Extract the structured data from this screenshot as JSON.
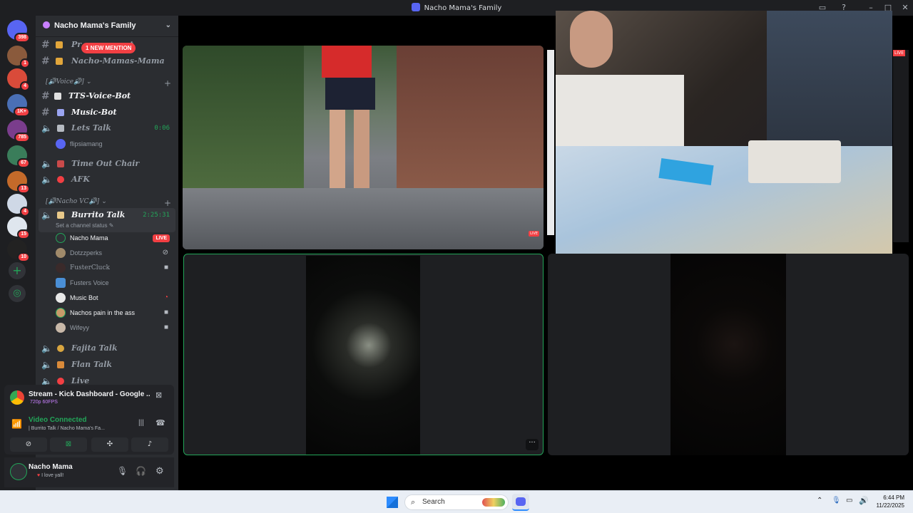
{
  "window": {
    "title": "Nacho Mama's Family"
  },
  "rail": {
    "badges": [
      "398",
      "1",
      "4",
      "1K+",
      "785",
      "67",
      "13",
      "4",
      "15",
      "10"
    ]
  },
  "guild": {
    "name": "Nacho Mama's Family",
    "mention_pill": "1 NEW MENTION"
  },
  "channels": {
    "text1": "Pr",
    "text1_tail": "t",
    "text2": "Nacho-Mamas-Mama",
    "cat_voice": "[🔊Voice🔊]",
    "tts": "TTS-Voice-Bot",
    "music": "Music-Bot",
    "lets_talk": "Lets Talk",
    "lets_talk_time": "0:06",
    "lets_talk_user": "flipsiamang",
    "timeout": "Time Out Chair",
    "afk": "AFK",
    "cat_nacho": "[🔊Nacho VC🔊]",
    "burrito": "Burrito Talk",
    "burrito_time": "2:25:31",
    "burrito_status": "Set a channel status",
    "fajita": "Fajita Talk",
    "flan": "Flan Talk",
    "live": "Live"
  },
  "burrito_users": [
    {
      "name": "Nacho Mama",
      "tag": "LIVE"
    },
    {
      "name": "Dotzzperks",
      "tag": ""
    },
    {
      "name": "FusterCluck",
      "tag": ""
    },
    {
      "name": "Fusters Voice",
      "tag": ""
    },
    {
      "name": "Music Bot",
      "tag": ""
    },
    {
      "name": "Nachos pain in the ass",
      "tag": ""
    },
    {
      "name": "Wifeyy",
      "tag": ""
    }
  ],
  "stream_panel": {
    "title": "Stream - Kick Dashboard - Google ...",
    "quality": "720p 60FPS",
    "voice_status": "Video Connected",
    "voice_channel": "| Burrito Talk / Nacho Mama's Fa..."
  },
  "user_panel": {
    "username": "Nacho Mama",
    "status": "I love yall!"
  },
  "stage": {
    "live_tag": "LIVE"
  },
  "taskbar": {
    "search_label": "Search",
    "time": "6:44 PM",
    "date": "11/22/2025"
  },
  "colors": {
    "accent": "#5865f2",
    "online": "#23a559",
    "danger": "#f23f43"
  }
}
